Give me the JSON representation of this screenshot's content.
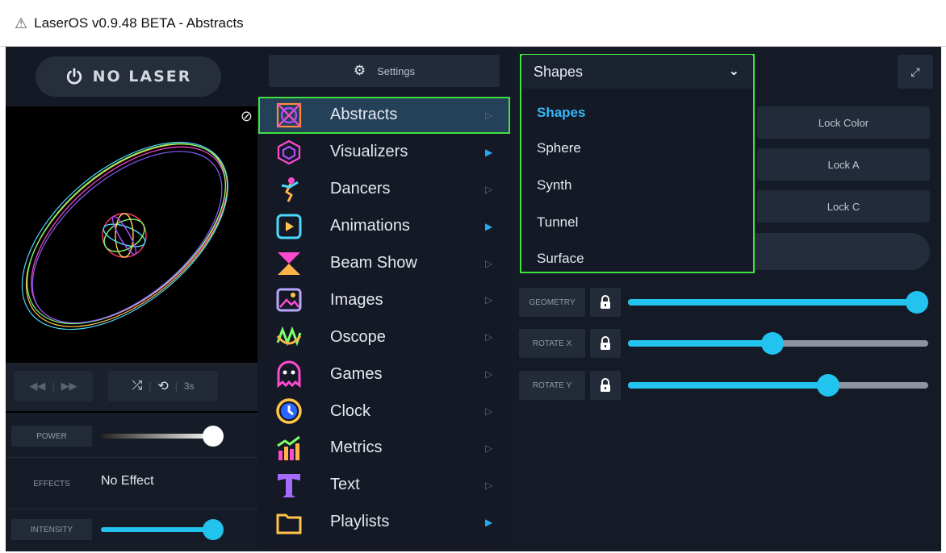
{
  "window": {
    "title": "LaserOS v0.9.48 BETA - Abstracts",
    "warning_icon": "warning-triangle-icon"
  },
  "left_panel": {
    "power_button": {
      "label": "NO LASER",
      "icon": "power-icon"
    },
    "transport": {
      "duration": "3s"
    },
    "power": {
      "label": "POWER",
      "level": 1.0
    },
    "effects": {
      "label": "EFFECTS",
      "value": "No Effect"
    },
    "intensity": {
      "label": "INTENSITY",
      "level": 1.0
    }
  },
  "middle_panel": {
    "settings_button": "Settings",
    "menu": [
      {
        "label": "Abstracts",
        "icon": "abstracts-icon",
        "selected": true,
        "arrow_active": false
      },
      {
        "label": "Visualizers",
        "icon": "visualizers-icon",
        "selected": false,
        "arrow_active": true
      },
      {
        "label": "Dancers",
        "icon": "dancers-icon",
        "selected": false,
        "arrow_active": false
      },
      {
        "label": "Animations",
        "icon": "animations-icon",
        "selected": false,
        "arrow_active": true
      },
      {
        "label": "Beam Show",
        "icon": "beam-show-icon",
        "selected": false,
        "arrow_active": false
      },
      {
        "label": "Images",
        "icon": "images-icon",
        "selected": false,
        "arrow_active": false
      },
      {
        "label": "Oscope",
        "icon": "oscope-icon",
        "selected": false,
        "arrow_active": false
      },
      {
        "label": "Games",
        "icon": "games-icon",
        "selected": false,
        "arrow_active": false
      },
      {
        "label": "Clock",
        "icon": "clock-icon",
        "selected": false,
        "arrow_active": false
      },
      {
        "label": "Metrics",
        "icon": "metrics-icon",
        "selected": false,
        "arrow_active": false
      },
      {
        "label": "Text",
        "icon": "text-icon",
        "selected": false,
        "arrow_active": false
      },
      {
        "label": "Playlists",
        "icon": "playlists-icon",
        "selected": false,
        "arrow_active": true
      }
    ]
  },
  "right_panel": {
    "dropdown": {
      "selected": "Shapes",
      "options": [
        "Shapes",
        "Sphere",
        "Synth",
        "Tunnel",
        "Surface"
      ]
    },
    "lock_buttons": [
      "Lock Color",
      "Lock A",
      "Lock C"
    ],
    "params": [
      {
        "label": "GEOMETRY",
        "value": 1.0
      },
      {
        "label": "ROTATE X",
        "value": 0.48
      },
      {
        "label": "ROTATE Y",
        "value": 0.68
      }
    ]
  },
  "colors": {
    "accent": "#22c4ef",
    "highlight_outline": "#3fe23f",
    "selected_bg": "#25415a"
  }
}
